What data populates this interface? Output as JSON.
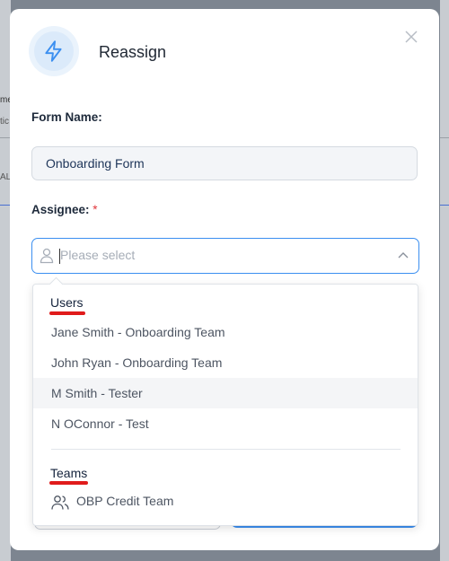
{
  "background": {
    "left_texts": [
      "me",
      "tic",
      "AL"
    ]
  },
  "modal": {
    "title": "Reassign",
    "icon": "lightning-icon",
    "close_icon": "close-icon",
    "form_name_label": "Form Name:",
    "form_name_value": "Onboarding Form",
    "assignee_label": "Assignee:",
    "required_mark": "*",
    "assignee_placeholder": "Please select"
  },
  "dropdown": {
    "users_label": "Users",
    "users": [
      "Jane Smith - Onboarding Team",
      "John Ryan - Onboarding Team",
      "M Smith - Tester",
      "N OConnor - Test"
    ],
    "hovered_user": "M Smith - Tester",
    "teams_label": "Teams",
    "teams": [
      "OBP Credit Team"
    ]
  },
  "colors": {
    "accent": "#3b8ff0",
    "annotation": "#e01b1b"
  }
}
